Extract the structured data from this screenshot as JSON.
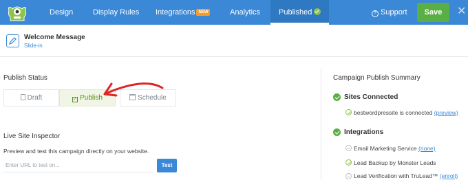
{
  "topbar": {
    "tabs": [
      {
        "label": "Design"
      },
      {
        "label": "Display Rules"
      },
      {
        "label": "Integrations",
        "badge": "NEW"
      },
      {
        "label": "Analytics"
      },
      {
        "label": "Published"
      }
    ],
    "support_label": "Support",
    "save_label": "Save",
    "close_icon": "close-icon",
    "colors": {
      "bar": "#3a88d6",
      "save": "#5aaf44",
      "badge": "#f39c2c"
    }
  },
  "campaign": {
    "name": "Welcome Message",
    "type": "Slide-in"
  },
  "publish_status": {
    "title": "Publish Status",
    "options": [
      {
        "label": "Draft",
        "icon": "document-icon"
      },
      {
        "label": "Publish",
        "icon": "checkbox-icon",
        "selected": true
      },
      {
        "label": "Schedule",
        "icon": "calendar-icon"
      }
    ]
  },
  "inspector": {
    "title": "Live Site Inspector",
    "description": "Preview and test this campaign directly on your website.",
    "placeholder": "Enter URL to test on...",
    "test_label": "Test"
  },
  "summary": {
    "title": "Campaign Publish Summary",
    "sites": {
      "heading": "Sites Connected",
      "items": [
        {
          "text": "bestwordpressite is connected",
          "link": "(preview)"
        }
      ]
    },
    "integrations": {
      "heading": "Integrations",
      "items": [
        {
          "text": "Email Marketing Service",
          "link": "(none)"
        },
        {
          "text": "Lead Backup by Monster Leads",
          "link": ""
        },
        {
          "text": "Lead Verification with TruLead™",
          "link": "(enroll)"
        }
      ]
    }
  }
}
